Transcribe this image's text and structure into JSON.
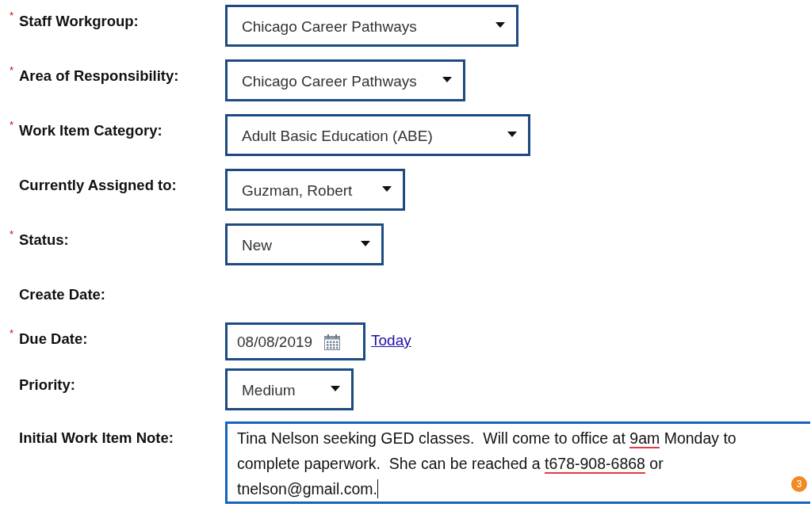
{
  "fields": [
    {
      "label": "Staff Workgroup:",
      "required_mark": "*",
      "kind": "select",
      "value": "Chicago Career Pathways"
    },
    {
      "label": "Area of Responsibility:",
      "required_mark": "*",
      "kind": "select",
      "value": "Chicago Career Pathways"
    },
    {
      "label": "Work Item Category:",
      "required_mark": "*",
      "kind": "select",
      "value": "Adult Basic Education (ABE)"
    },
    {
      "label": "Currently Assigned to:",
      "kind": "select",
      "value": "Guzman, Robert"
    },
    {
      "label": "Status:",
      "required_mark": "*",
      "kind": "select",
      "value": "New"
    },
    {
      "label": "Create Date:",
      "kind": "text"
    },
    {
      "label": "Due Date:",
      "required_mark": "*",
      "kind": "date",
      "value": "08/08/2019",
      "link": "Today"
    },
    {
      "label": "Priority:",
      "kind": "select",
      "value": "Medium"
    },
    {
      "label": "Initial Work Item Note:",
      "kind": "note",
      "focused": true,
      "badge": "3",
      "segments": [
        {
          "text": "Tina Nelson seeking GED classes.  Will come to office at ",
          "misspelled": false
        },
        {
          "text": "9am",
          "misspelled": true
        },
        {
          "text": " Monday to complete paperwork.  She can be reached a ",
          "misspelled": false
        },
        {
          "text": "t678-908-6868",
          "misspelled": true
        },
        {
          "text": " or tnelson@gmail.com.",
          "misspelled": false
        }
      ]
    }
  ]
}
